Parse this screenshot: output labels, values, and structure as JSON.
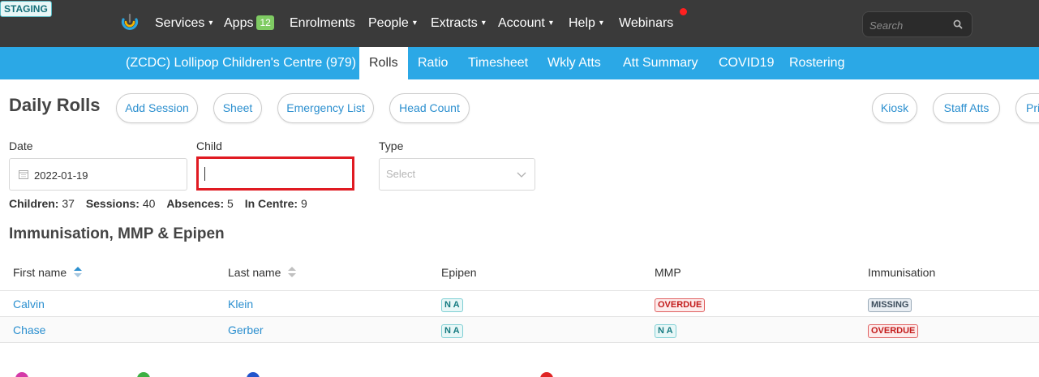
{
  "env_badge": "STAGING",
  "nav": {
    "items": [
      {
        "label": "Services",
        "caret": "▾"
      },
      {
        "label": "Apps",
        "badge": "12"
      },
      {
        "label": "Enrolments"
      },
      {
        "label": "People",
        "caret": "▾"
      },
      {
        "label": "Extracts",
        "caret": "▾"
      },
      {
        "label": "Account",
        "caret": "▾"
      },
      {
        "label": "Help",
        "caret": "▾"
      },
      {
        "label": "Webinars"
      }
    ],
    "search_placeholder": "Search"
  },
  "subnav": {
    "items": [
      "(ZCDC) Lollipop Children's Centre (979)",
      "Rolls",
      "Ratio",
      "Timesheet",
      "Wkly Atts",
      "Att Summary",
      "COVID19",
      "Rostering"
    ],
    "active": "Rolls"
  },
  "page": {
    "title": "Daily Rolls",
    "actions": [
      "Add Session",
      "Sheet",
      "Emergency List",
      "Head Count"
    ],
    "right_actions": [
      "Kiosk",
      "Staff Atts",
      "Pri"
    ]
  },
  "filters": {
    "date_label": "Date",
    "date_value": "2022-01-19",
    "child_label": "Child",
    "child_value": "",
    "type_label": "Type",
    "type_placeholder": "Select"
  },
  "stats": {
    "children_label": "Children:",
    "children": "37",
    "sessions_label": "Sessions:",
    "sessions": "40",
    "absences_label": "Absences:",
    "absences": "5",
    "in_centre_label": "In Centre:",
    "in_centre": "9"
  },
  "section": {
    "title": "Immunisation, MMP & Epipen",
    "columns": [
      "First name",
      "Last name",
      "Epipen",
      "MMP",
      "Immunisation"
    ],
    "rows": [
      {
        "first": "Calvin",
        "last": "Klein",
        "epipen": "N A",
        "mmp": "OVERDUE",
        "immunisation": "MISSING"
      },
      {
        "first": "Chase",
        "last": "Gerber",
        "epipen": "N A",
        "mmp": "N A",
        "immunisation": "OVERDUE"
      }
    ]
  },
  "colors": {
    "topbar": "#3a3a3a",
    "subnav": "#2ba8e6",
    "link": "#2b8fcf",
    "highlight": "#e01a22"
  }
}
